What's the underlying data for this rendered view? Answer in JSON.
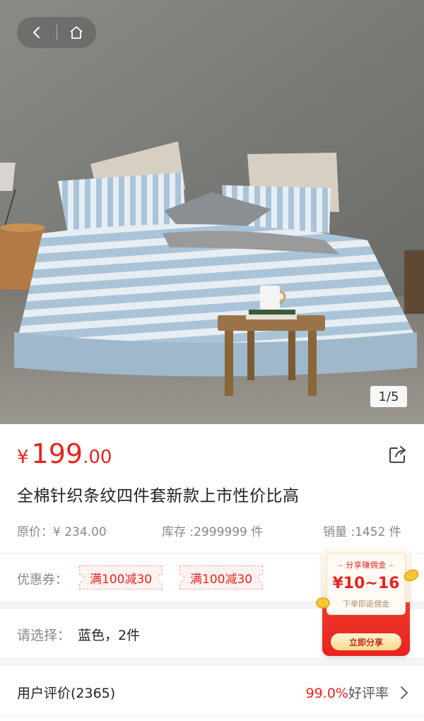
{
  "navigation": {
    "back_icon": "chevron-left-icon",
    "home_icon": "home-icon"
  },
  "gallery": {
    "indicator": "1/5",
    "current": 1,
    "total": 5
  },
  "product": {
    "currency": "¥",
    "price_integer": "199",
    "price_decimal": ".00",
    "title": "全棉针织条纹四件套新款上市性价比高",
    "original_price": "原价：¥ 234.00",
    "stock": "库存 :2999999 件",
    "sales": "销量 :1452 件",
    "share_icon": "share-icon"
  },
  "coupons": {
    "label": "优惠券：",
    "items": [
      "满100减30",
      "满100减30"
    ]
  },
  "selection": {
    "label": "请选择：",
    "value": "蓝色，2件"
  },
  "reviews": {
    "label": "用户评价(2365)",
    "rate_value": "99.0%",
    "rate_suffix": "好评率",
    "chevron_icon": "chevron-right-icon"
  },
  "commission": {
    "tag": "– 分享赚佣金 –",
    "amount": "¥10~16",
    "sub": "下单即返佣金",
    "button": "立即分享"
  },
  "colors": {
    "accent": "#e8231f",
    "muted_text": "#888888",
    "section_gap": "#f4f4f4"
  }
}
